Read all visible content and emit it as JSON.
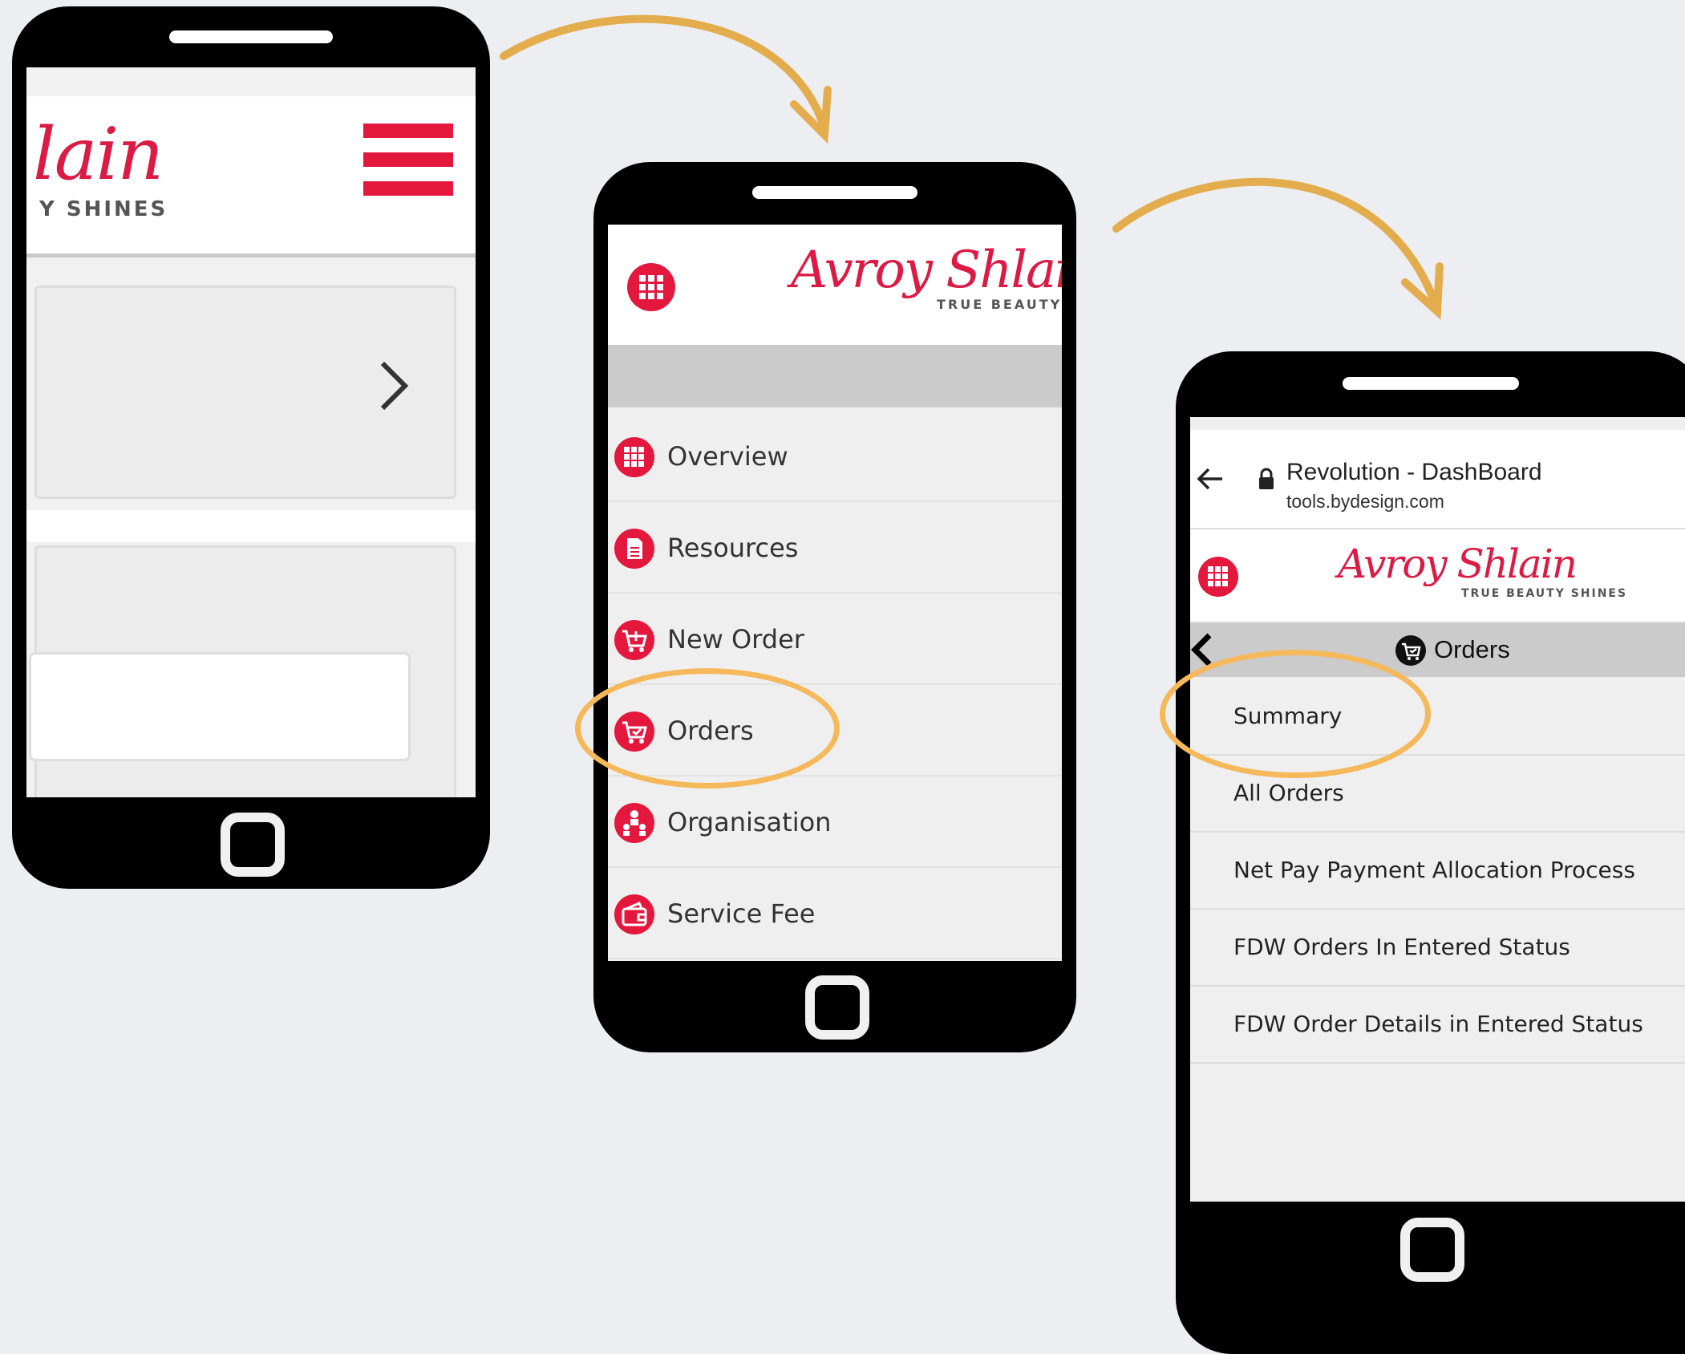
{
  "phone1": {
    "logo_fragment": "lain",
    "tagline_fragment": "Y SHINES"
  },
  "phone2": {
    "logo": "Avroy Shlain",
    "tagline": "TRUE BEAUTY",
    "menu": [
      {
        "label": "Overview",
        "icon": "grid-icon"
      },
      {
        "label": "Resources",
        "icon": "document-icon"
      },
      {
        "label": "New Order",
        "icon": "cart-plus-icon"
      },
      {
        "label": "Orders",
        "icon": "cart-icon"
      },
      {
        "label": "Organisation",
        "icon": "people-icon"
      },
      {
        "label": "Service Fee",
        "icon": "wallet-icon"
      }
    ]
  },
  "phone3": {
    "browser_title": "Revolution - DashBoard",
    "browser_url": "tools.bydesign.com",
    "logo": "Avroy Shlain",
    "tagline": "TRUE BEAUTY SHINES",
    "section_title": "Orders",
    "submenu": [
      "Summary",
      "All Orders",
      "Net Pay Payment Allocation Process",
      "FDW Orders In Entered Status",
      "FDW Order Details in Entered Status"
    ]
  },
  "colors": {
    "brand_red": "#e4173d",
    "highlight_orange": "#f5b85a",
    "arrow_gold": "#e3ad4d",
    "phone_body": "#000000",
    "background": "#eceef2"
  }
}
